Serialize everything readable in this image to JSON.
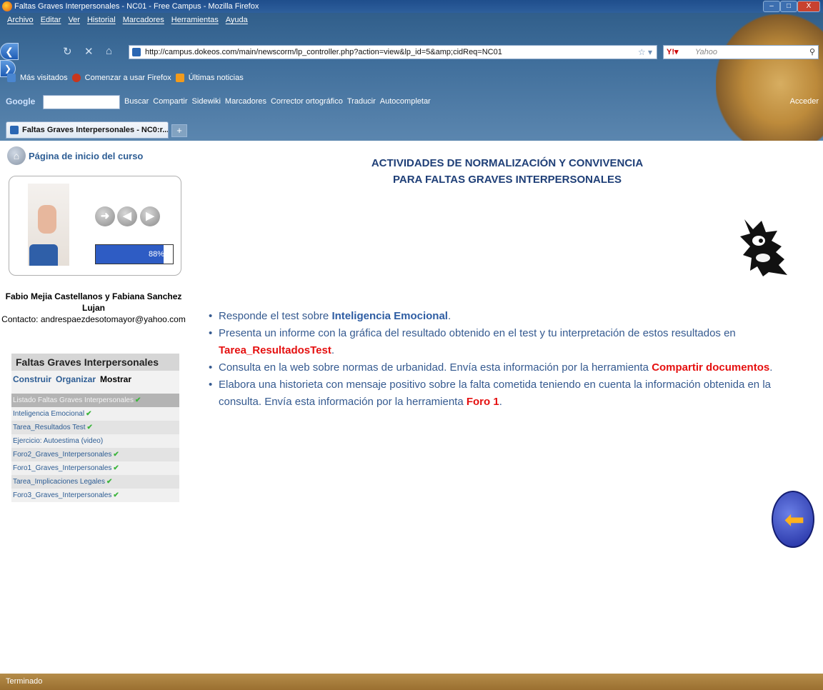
{
  "browser": {
    "window_title": "Faltas Graves Interpersonales - NC01 - Free Campus - Mozilla Firefox",
    "menu": [
      "Archivo",
      "Editar",
      "Ver",
      "Historial",
      "Marcadores",
      "Herramientas",
      "Ayuda"
    ],
    "url": "http://campus.dokeos.com/main/newscorm/lp_controller.php?action=view&lp_id=5&amp;cidReq=NC01",
    "search_placeholder": "Yahoo",
    "bookmarks": [
      "Más visitados",
      "Comenzar a usar Firefox",
      "Últimas noticias"
    ],
    "google_logo": "Google",
    "google_items": [
      "Buscar",
      "Compartir",
      "Sidewiki",
      "Marcadores",
      "Corrector ortográfico",
      "Traducir",
      "Autocompletar"
    ],
    "google_acceder": "Acceder",
    "tab_title": "Faltas Graves Interpersonales - NC0:r...",
    "new_tab": "+",
    "status": "Terminado"
  },
  "sidebar": {
    "home_link": "Página de inicio del curso",
    "progress": "88%",
    "progress_value": 88,
    "authors": "Fabio Mejia Castellanos y Fabiana Sanchez Lujan",
    "contact": "Contacto: andrespaezdesotomayor@yahoo.com",
    "toc_title": "Faltas Graves Interpersonales",
    "toc_tabs": [
      "Construir",
      "Organizar",
      "Mostrar"
    ],
    "toc_items": [
      {
        "label": "Listado Faltas Graves Interpersonales",
        "done": true
      },
      {
        "label": "Inteligencia Emocional",
        "done": true
      },
      {
        "label": "Tarea_Resultados Test",
        "done": true
      },
      {
        "label": "Ejercicio: Autoestima (video)",
        "done": false
      },
      {
        "label": "Foro2_Graves_Interpersonales",
        "done": true
      },
      {
        "label": "Foro1_Graves_Interpersonales",
        "done": true
      },
      {
        "label": "Tarea_Implicaciones Legales",
        "done": true
      },
      {
        "label": "Foro3_Graves_Interpersonales",
        "done": true
      }
    ]
  },
  "main": {
    "heading_line1": "ACTIVIDADES DE NORMALIZACIÓN Y CONVIVENCIA",
    "heading_line2": "PARA FALTAS GRAVES INTERPERSONALES",
    "b1_pre": "Responde el test sobre ",
    "b1_hl": "Inteligencia Emocional",
    "b1_post": ".",
    "b2_pre": "Presenta un informe con la gráfica del resultado obtenido en el test y tu interpretación de estos resultados en ",
    "b2_hl": "Tarea_ResultadosTest",
    "b2_post": ".",
    "b3_pre": "Consulta en la web sobre normas de urbanidad. Envía esta información por la herramienta ",
    "b3_hl": "Compartir documentos",
    "b3_post": ".",
    "b4_pre": "Elabora una historieta con mensaje positivo sobre la falta cometida teniendo en cuenta la información obtenida en la consulta. Envía esta información por la herramienta ",
    "b4_hl": "Foro 1",
    "b4_post": "."
  }
}
